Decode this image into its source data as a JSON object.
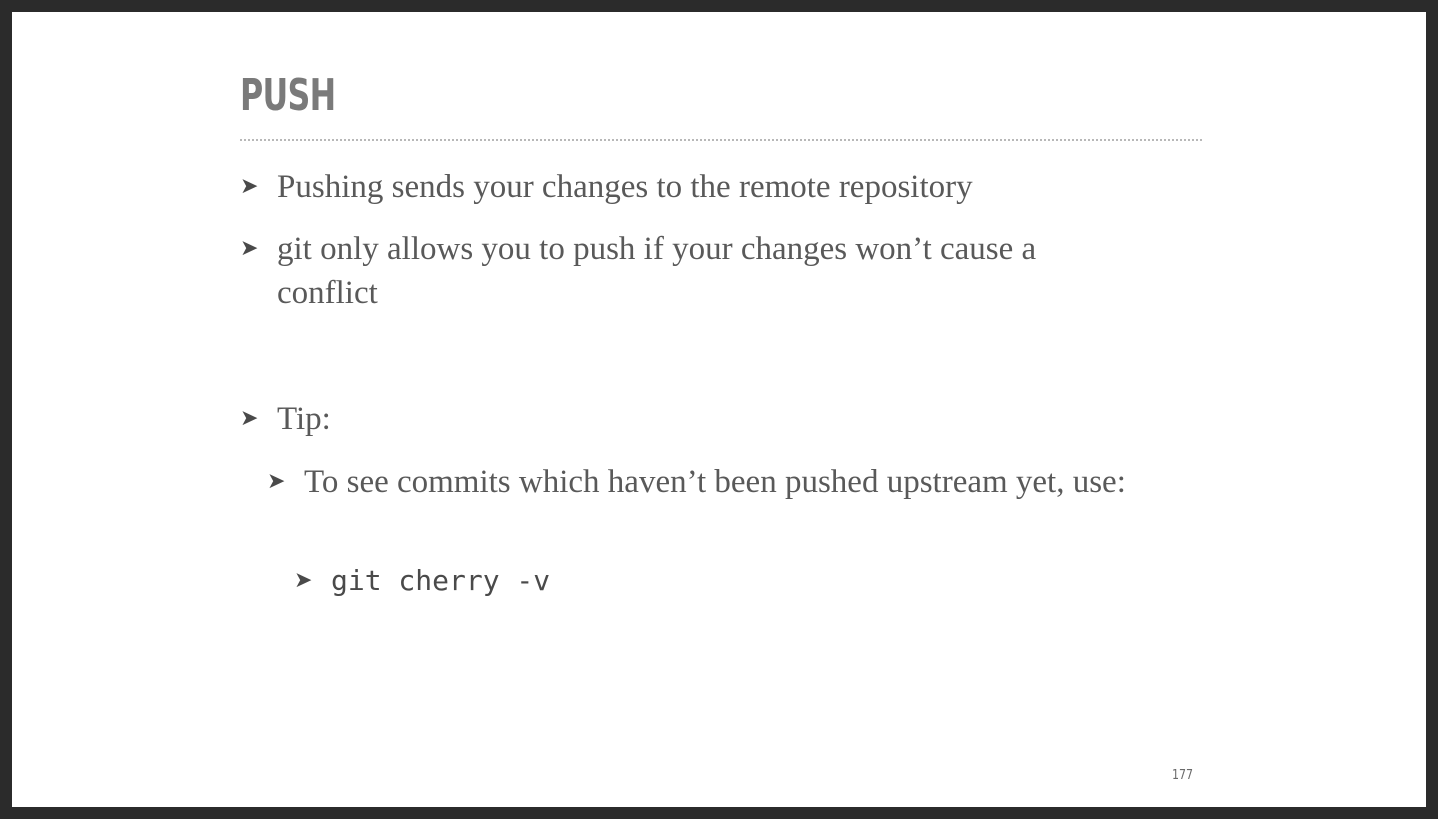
{
  "slide": {
    "title": "PUSH",
    "bullets": [
      {
        "text": "Pushing sends your changes to the remote repository"
      },
      {
        "text": "git only allows you to push if your changes won’t cause a conflict"
      },
      {
        "text": "Tip:"
      },
      {
        "text": "To see commits which haven’t been pushed upstream yet, use:"
      },
      {
        "text": "git cherry -v"
      }
    ],
    "bullet_glyph": "➤",
    "page_number": "177"
  },
  "colors": {
    "title": "#7a7a7a",
    "body_text": "#595959",
    "frame": "#2b2b2b",
    "background": "#ffffff"
  },
  "icons": {
    "bullet": "arrowhead-bullet-icon"
  }
}
